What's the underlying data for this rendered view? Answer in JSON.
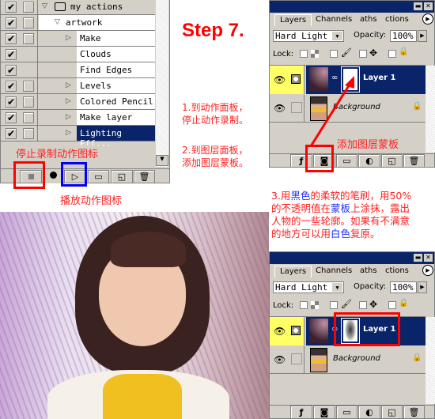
{
  "actions_panel": {
    "rows": [
      {
        "label": "my actions",
        "level": 0,
        "expanded": true,
        "folder": true,
        "dialog_box": true
      },
      {
        "label": "artwork",
        "level": 1,
        "expanded": true,
        "dialog_box": true
      },
      {
        "label": "Make",
        "level": 2,
        "has_children": true,
        "dialog_box": true
      },
      {
        "label": "Clouds",
        "level": 2,
        "dialog_box": false
      },
      {
        "label": "Find Edges",
        "level": 2,
        "dialog_box": false
      },
      {
        "label": "Levels",
        "level": 2,
        "has_children": true,
        "dialog_box": true
      },
      {
        "label": "Colored Pencil",
        "level": 2,
        "has_children": true,
        "dialog_box": true
      },
      {
        "label": "Make layer",
        "level": 2,
        "has_children": true,
        "dialog_box": true
      },
      {
        "label": "Lighting Eff...",
        "level": 2,
        "has_children": true,
        "selected": true,
        "dialog_box": true
      }
    ],
    "toolbar": [
      "stop-icon",
      "record-icon",
      "play-icon",
      "folder-icon",
      "new-action-icon",
      "trash-icon"
    ],
    "stop_annotation": "停止录制动作图标",
    "play_annotation": "播放动作图标"
  },
  "step_title": "Step 7.",
  "instructions_1": [
    "1.到动作面板，",
    "停止动作录制。"
  ],
  "instructions_2": [
    "2.到图层面板，",
    "添加图层蒙板。"
  ],
  "instructions_3": {
    "line1": [
      "3.用",
      "黑色",
      "的柔软的笔刷，用50%"
    ],
    "line2": [
      "的不透明值在",
      "蒙板",
      "上涂抹，露出"
    ],
    "line3": "人物的一些轮廓。如果有不满意",
    "line4": [
      "的地方可以用",
      "白色",
      "复原。"
    ]
  },
  "layers_panel": {
    "tabs": [
      "Layers",
      "Channels",
      "Paths",
      "Actions"
    ],
    "tabs_visible": [
      "Layers",
      "Channels",
      "aths",
      "ctions"
    ],
    "blend_mode": "Hard Light",
    "opacity_label": "Opacity:",
    "opacity": "100%",
    "lock_label": "Lock:",
    "layers": [
      {
        "name": "Layer 1",
        "selected": true
      },
      {
        "name": "Background",
        "locked": true
      }
    ],
    "mask_annotation": "添加图层蒙板"
  },
  "colors": {
    "annotation_red": "#ff2020",
    "annotation_blue": "#2030ff",
    "selection": "#0a246a",
    "panel": "#d4d0c8",
    "active_eye": "#ffff66"
  }
}
